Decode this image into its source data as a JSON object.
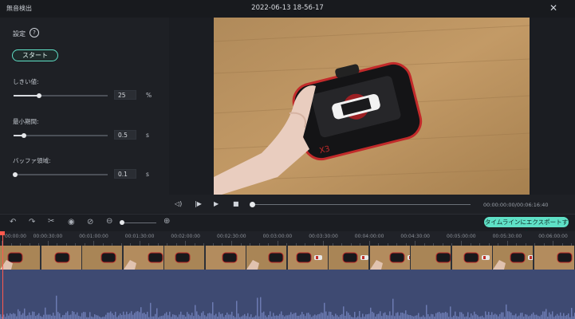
{
  "window": {
    "app_title": "無音検出",
    "file_title": "2022-06-13 18-56-17",
    "close_glyph": "✕"
  },
  "settings": {
    "label": "設定",
    "help_glyph": "?",
    "start_label": "スタート",
    "params": [
      {
        "label": "しきい値:",
        "value": "25",
        "unit": "%",
        "level": 0.27
      },
      {
        "label": "最小期間:",
        "value": "0.5",
        "unit": "s",
        "level": 0.11
      },
      {
        "label": "バッファ領域:",
        "value": "0.1",
        "unit": "s",
        "level": 0.02
      }
    ]
  },
  "player": {
    "time_readout": "00:00:00:00/00:06:16:40",
    "progress": 0.0
  },
  "toolbar": {
    "export_label": "タイムラインにエクスポートする",
    "zoom_level": 0.0
  },
  "timeline": {
    "ticks": [
      "00:00:00",
      "00:00:30:00",
      "00:01:00:00",
      "00:01:30:00",
      "00:02:00:00",
      "00:02:30:00",
      "00:03:00:00",
      "00:03:30:00",
      "00:04:00:00",
      "00:04:30:00",
      "00:05:00:00",
      "00:05:30:00",
      "00:06:00:00"
    ]
  },
  "colors": {
    "accent": "#5fe0c6",
    "playhead": "#ff5a4e",
    "waveform": "#6c7bb2"
  }
}
